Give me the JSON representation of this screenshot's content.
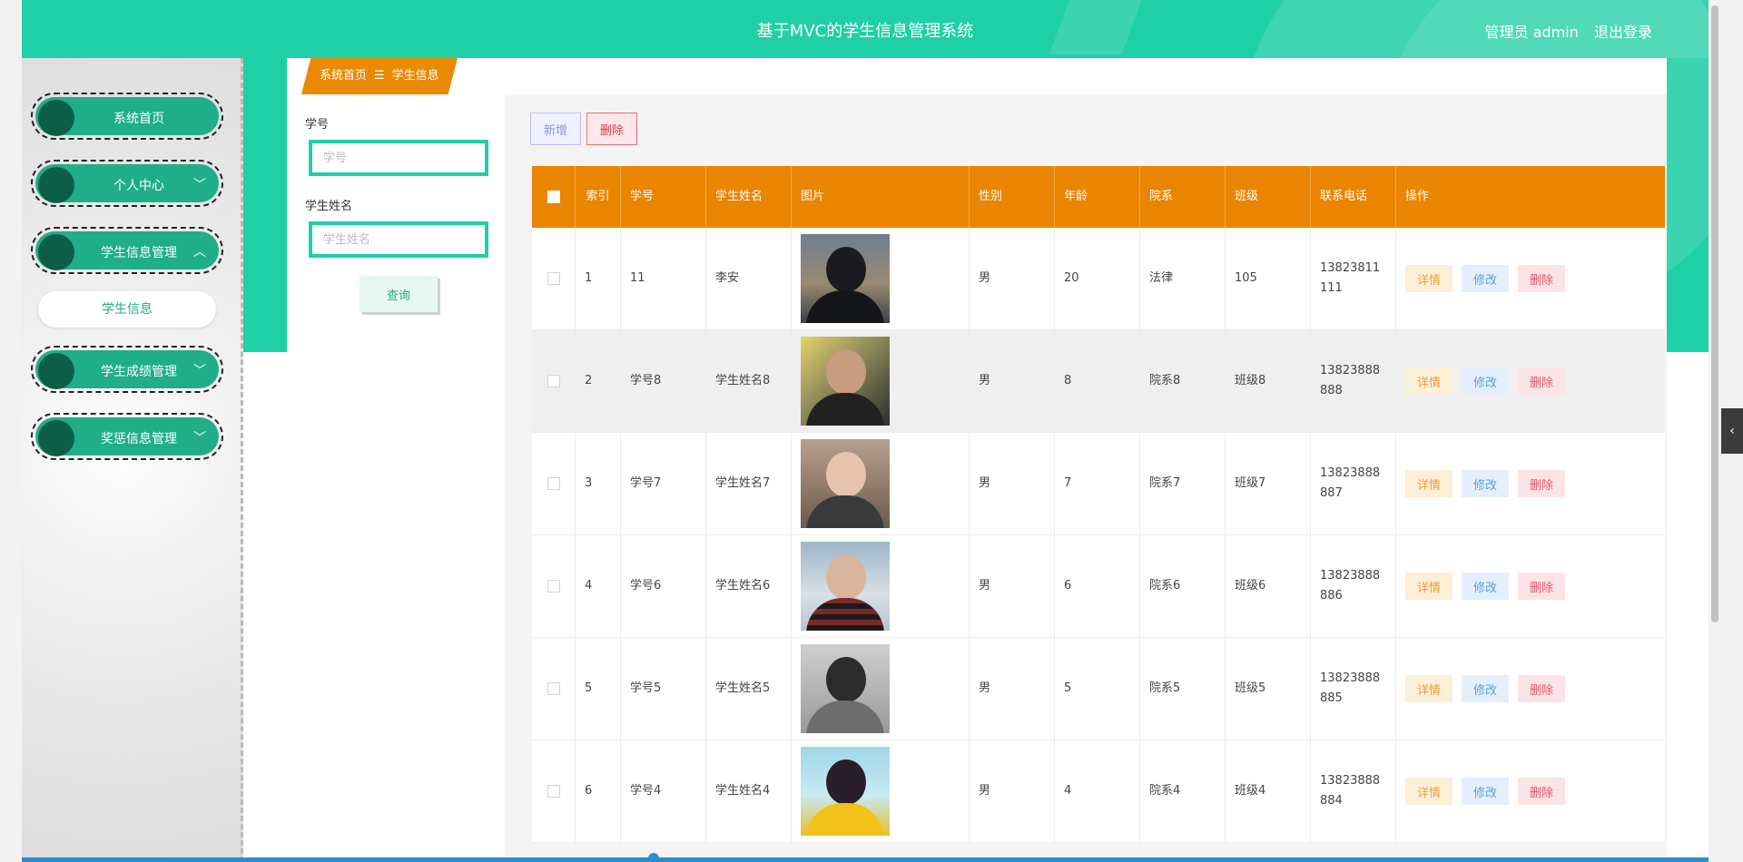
{
  "header": {
    "title": "基于MVC的学生信息管理系统",
    "user": "管理员 admin",
    "logout": "退出登录"
  },
  "sidebar": {
    "items": [
      {
        "label": "系统首页",
        "has_arrow": false
      },
      {
        "label": "个人中心",
        "has_arrow": true,
        "arrow": "﹀"
      },
      {
        "label": "学生信息管理",
        "has_arrow": true,
        "arrow": "︿"
      },
      {
        "label": "学生成绩管理",
        "has_arrow": true,
        "arrow": "﹀"
      },
      {
        "label": "奖惩信息管理",
        "has_arrow": true,
        "arrow": "﹀"
      }
    ],
    "submenu": {
      "label": "学生信息"
    }
  },
  "breadcrumb": {
    "home": "系统首页",
    "separator": "☰",
    "current": "学生信息"
  },
  "search": {
    "student_no_label": "学号",
    "student_no_placeholder": "学号",
    "student_name_label": "学生姓名",
    "student_name_placeholder": "学生姓名",
    "query_button": "查询"
  },
  "toolbar": {
    "add_label": "新增",
    "delete_label": "删除"
  },
  "table": {
    "headers": {
      "index": "索引",
      "student_no": "学号",
      "student_name": "学生姓名",
      "photo": "图片",
      "gender": "性别",
      "age": "年龄",
      "department": "院系",
      "class": "班级",
      "phone": "联系电话",
      "actions": "操作"
    },
    "actions": {
      "detail": "详情",
      "edit": "修改",
      "delete": "删除"
    },
    "rows": [
      {
        "index": "1",
        "student_no": "11",
        "student_name": "李安",
        "gender": "男",
        "age": "20",
        "department": "法律",
        "class": "105",
        "phone": "13823811111"
      },
      {
        "index": "2",
        "student_no": "学号8",
        "student_name": "学生姓名8",
        "gender": "男",
        "age": "8",
        "department": "院系8",
        "class": "班级8",
        "phone": "13823888888"
      },
      {
        "index": "3",
        "student_no": "学号7",
        "student_name": "学生姓名7",
        "gender": "男",
        "age": "7",
        "department": "院系7",
        "class": "班级7",
        "phone": "13823888887"
      },
      {
        "index": "4",
        "student_no": "学号6",
        "student_name": "学生姓名6",
        "gender": "男",
        "age": "6",
        "department": "院系6",
        "class": "班级6",
        "phone": "13823888886"
      },
      {
        "index": "5",
        "student_no": "学号5",
        "student_name": "学生姓名5",
        "gender": "男",
        "age": "5",
        "department": "院系5",
        "class": "班级5",
        "phone": "13823888885"
      },
      {
        "index": "6",
        "student_no": "学号4",
        "student_name": "学生姓名4",
        "gender": "男",
        "age": "4",
        "department": "院系4",
        "class": "班级4",
        "phone": "13823888884"
      }
    ]
  },
  "colors": {
    "primary": "#1fcfa6",
    "sidebar_item": "#1fae88",
    "table_header": "#e98500",
    "breadcrumb": "#e98a00"
  }
}
